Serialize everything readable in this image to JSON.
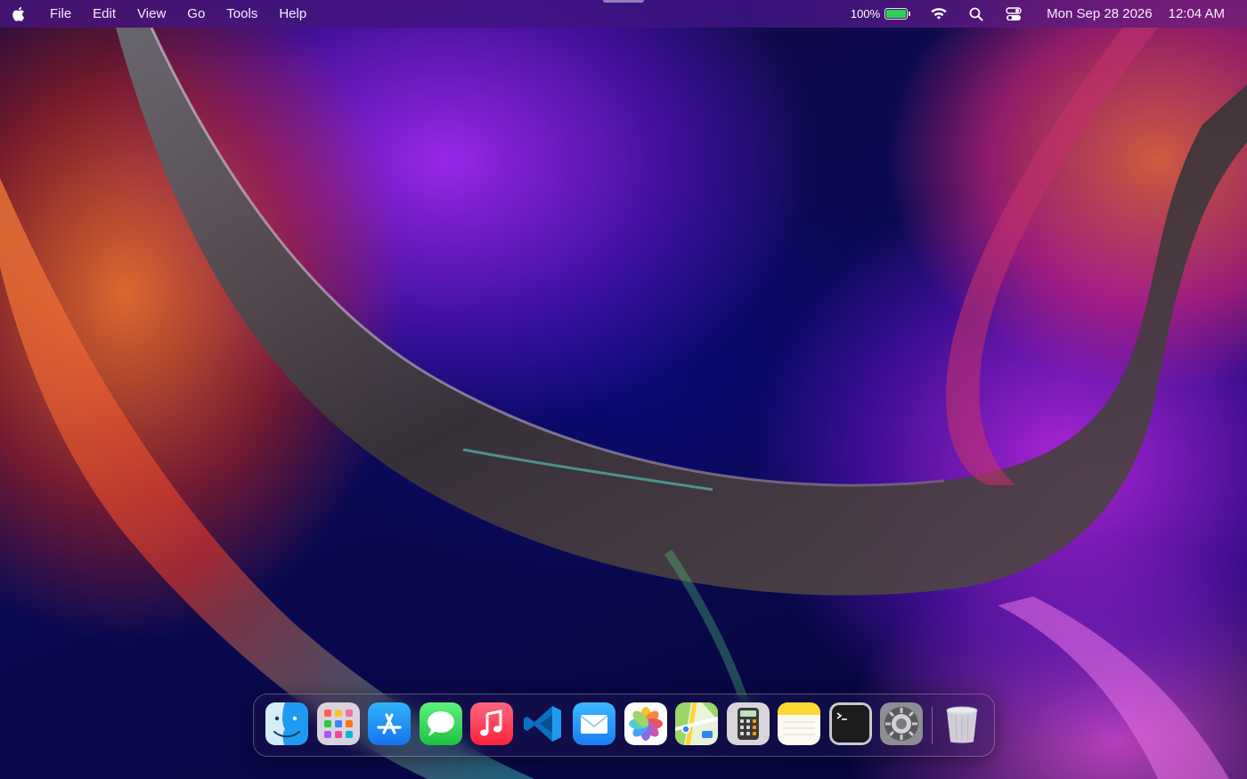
{
  "menubar": {
    "menus": [
      "File",
      "Edit",
      "View",
      "Go",
      "Tools",
      "Help"
    ],
    "status": {
      "battery_percent_label": "100%",
      "battery_level": 1.0,
      "date": "Mon Sep 28 2026",
      "time": "12:04 AM"
    },
    "icons": [
      "apple-icon",
      "battery-icon",
      "wifi-icon",
      "search-icon",
      "control-center-icon"
    ]
  },
  "dock": {
    "apps": [
      {
        "name": "Finder",
        "icon": "finder-icon"
      },
      {
        "name": "Launchpad",
        "icon": "launchpad-icon"
      },
      {
        "name": "App Store",
        "icon": "app-store-icon"
      },
      {
        "name": "Messages",
        "icon": "messages-icon"
      },
      {
        "name": "Music",
        "icon": "music-icon"
      },
      {
        "name": "Visual Studio Code",
        "icon": "vscode-icon"
      },
      {
        "name": "Mail",
        "icon": "mail-icon"
      },
      {
        "name": "Photos",
        "icon": "photos-icon"
      },
      {
        "name": "Maps",
        "icon": "maps-icon"
      },
      {
        "name": "Calculator",
        "icon": "calculator-icon"
      },
      {
        "name": "Notes",
        "icon": "notes-icon"
      },
      {
        "name": "Terminal",
        "icon": "terminal-icon"
      },
      {
        "name": "System Preferences",
        "icon": "system-preferences-icon"
      },
      {
        "name": "Trash",
        "icon": "trash-icon"
      }
    ]
  },
  "colors": {
    "battery_fill": "#30d158",
    "wallpaper_primary": "#0b0a55",
    "wallpaper_accent_purple": "#a028f0",
    "wallpaper_accent_orange": "#ff7828"
  }
}
